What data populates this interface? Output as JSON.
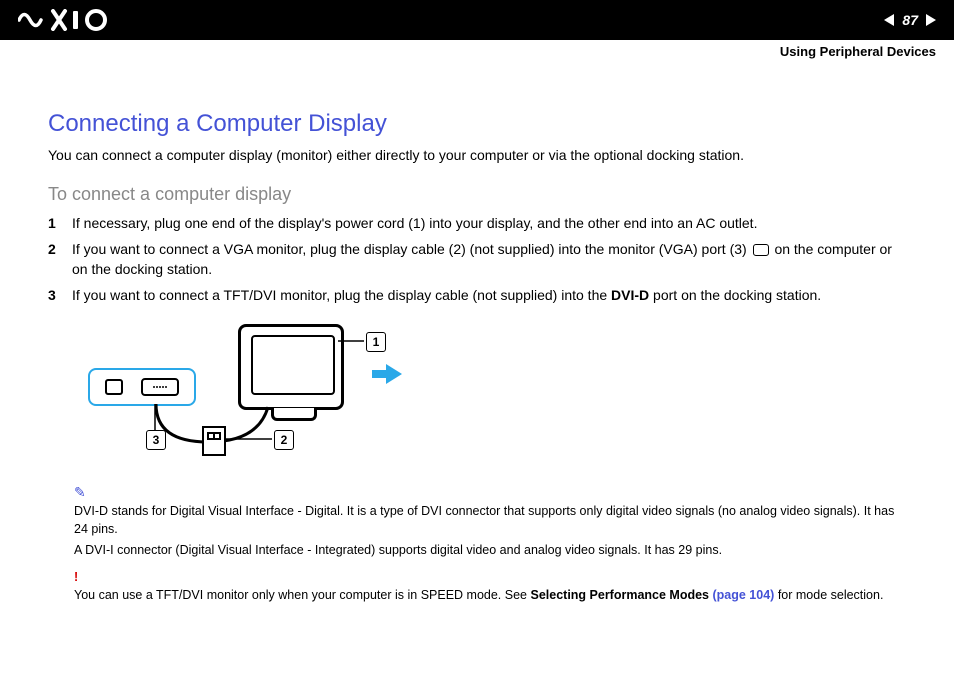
{
  "header": {
    "page_number": "87",
    "section": "Using Peripheral Devices"
  },
  "title": "Connecting a Computer Display",
  "intro": "You can connect a computer display (monitor) either directly to your computer or via the optional docking station.",
  "subtitle": "To connect a computer display",
  "steps": [
    "If necessary, plug one end of the display's power cord (1) into your display, and the other end into an AC outlet.",
    "If you want to connect a VGA monitor, plug the display cable (2) (not supplied) into the monitor (VGA) port (3) ▢ on the computer or on the docking station.",
    "If you want to connect a TFT/DVI monitor, plug the display cable (not supplied) into the DVI-D port on the docking station."
  ],
  "step_nums": [
    "1",
    "2",
    "3"
  ],
  "callouts": {
    "c1": "1",
    "c2": "2",
    "c3": "3"
  },
  "notes": {
    "note1": "DVI-D stands for Digital Visual Interface - Digital. It is a type of DVI connector that supports only digital video signals (no analog video signals). It has 24 pins.",
    "note2": "A DVI-I connector (Digital Visual Interface - Integrated) supports digital video and analog video signals. It has 29 pins.",
    "warn_pre": "You can use a TFT/DVI monitor only when your computer is in SPEED mode. See ",
    "warn_link_label": "Selecting Performance Modes",
    "warn_link_page": "(page 104)",
    "warn_post": " for mode selection."
  }
}
